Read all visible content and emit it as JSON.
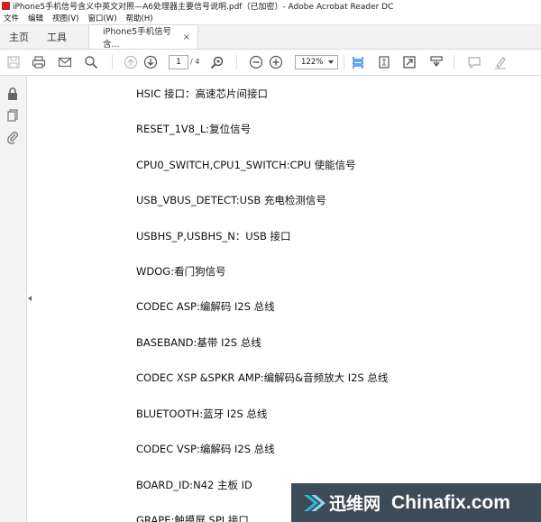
{
  "window": {
    "title": "iPhone5手机信号含义中英文对照—A6处理器主要信号说明.pdf（已加密）- Adobe Acrobat Reader DC"
  },
  "menu": {
    "items": [
      "文件",
      "编辑",
      "视图(V)",
      "窗口(W)",
      "帮助(H)"
    ]
  },
  "tabs": {
    "home": "主页",
    "tools": "工具",
    "document": "iPhone5手机信号含...",
    "close": "×"
  },
  "toolbar": {
    "page_current": "1",
    "page_total": "/ 4",
    "zoom": "122%"
  },
  "document": {
    "lines": [
      "HSIC 接口：高速芯片间接口",
      "RESET_1V8_L:复位信号",
      "CPU0_SWITCH,CPU1_SWITCH:CPU 使能信号",
      "USB_VBUS_DETECT:USB 充电检测信号",
      "USBHS_P,USBHS_N：USB 接口",
      "WDOG:看门狗信号",
      "CODEC ASP:编解码 I2S 总线",
      "BASEBAND:基带 I2S 总线",
      "CODEC XSP &SPKR AMP:编解码&音频放大 I2S 总线",
      "BLUETOOTH:蓝牙 I2S 总线",
      "CODEC VSP:编解码 I2S 总线",
      "BOARD_ID:N42 主板 ID",
      "GRAPE:触摸屏 SPI 接口"
    ]
  },
  "watermark": {
    "brand_cn": "迅维网",
    "brand_en": "Chinafix.com"
  },
  "colors": {
    "accent": "#1473e6",
    "watermark_bg": "#3d4a57",
    "watermark_logo": "#2bb5d6"
  }
}
